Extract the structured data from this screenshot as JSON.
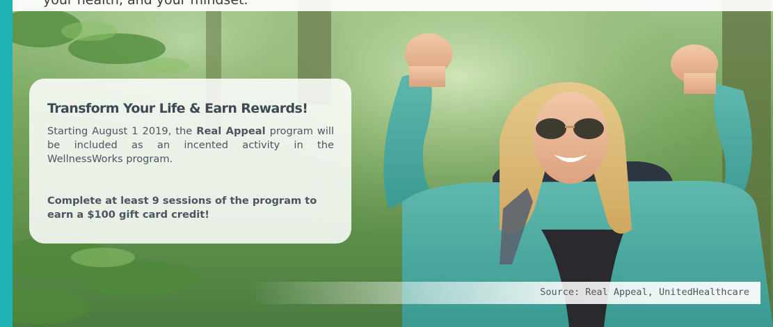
{
  "top_text": "your health, and your mindset.",
  "card": {
    "title": "Transform Your Life & Earn Rewards!",
    "body_prefix": "Starting August 1 2019, the ",
    "body_bold": "Real Appeal",
    "body_suffix": " program will be included as an incented activity in the WellnessWorks program.",
    "cta": "Complete at least 9 sessions of the program to earn a $100 gift card credit!"
  },
  "source": "Source: Real Appeal, UnitedHealthcare",
  "colors": {
    "accent": "#21b2b7",
    "text": "#4a5560",
    "title": "#3d4a55"
  }
}
